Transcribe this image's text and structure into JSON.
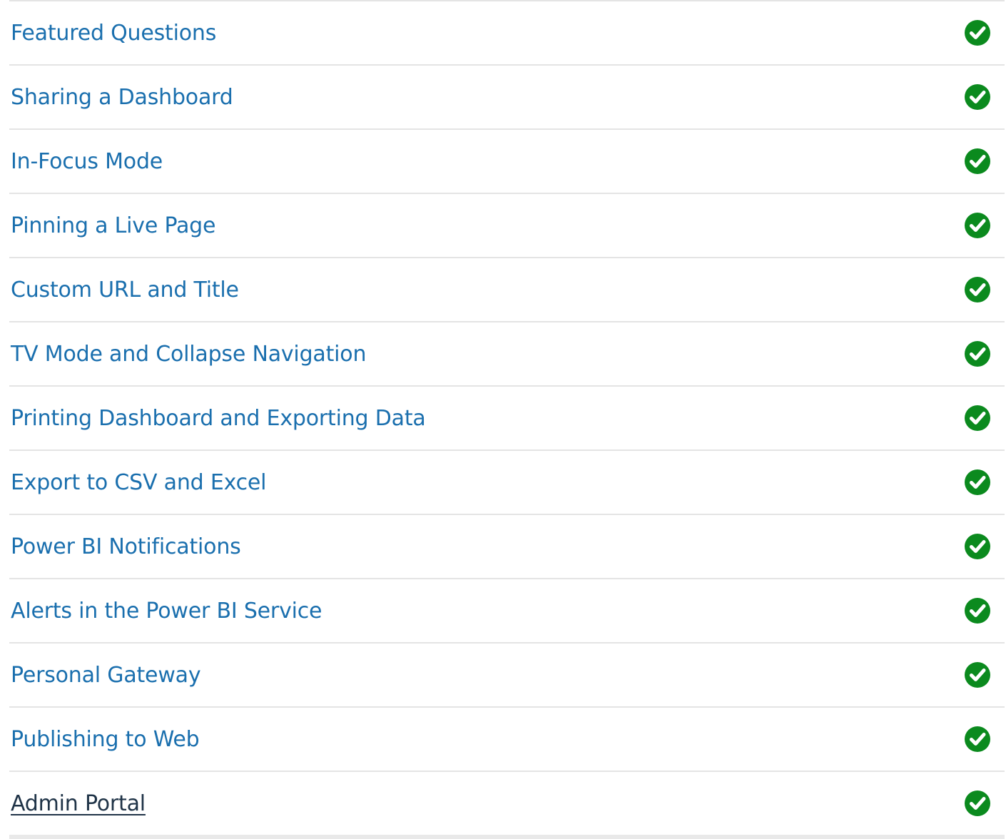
{
  "lessons": {
    "items": [
      {
        "label": "Featured Questions",
        "completed": true
      },
      {
        "label": "Sharing a Dashboard",
        "completed": true
      },
      {
        "label": "In-Focus Mode",
        "completed": true
      },
      {
        "label": "Pinning a Live Page",
        "completed": true
      },
      {
        "label": "Custom URL and Title",
        "completed": true
      },
      {
        "label": "TV Mode and Collapse Navigation",
        "completed": true
      },
      {
        "label": "Printing Dashboard and Exporting Data",
        "completed": true
      },
      {
        "label": "Export to CSV and Excel",
        "completed": true
      },
      {
        "label": "Power BI Notifications",
        "completed": true
      },
      {
        "label": "Alerts in the Power BI Service",
        "completed": true
      },
      {
        "label": "Personal Gateway",
        "completed": true
      },
      {
        "label": "Publishing to Web",
        "completed": true
      },
      {
        "label": "Admin Portal",
        "completed": true,
        "active": true
      }
    ]
  },
  "colors": {
    "link": "#1a6fae",
    "active_link": "#1f3347",
    "check": "#0b8a1e",
    "divider": "#e4e4e4"
  },
  "icons": {
    "completed": "check-circle-icon"
  }
}
